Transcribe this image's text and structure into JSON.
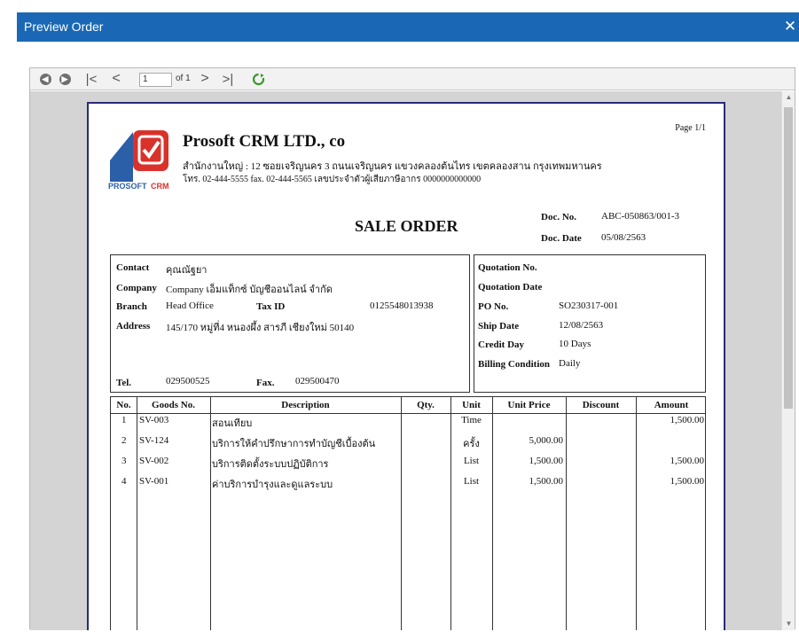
{
  "window": {
    "title": "Preview Order",
    "close_label": "✕"
  },
  "toolbar": {
    "page_value": "1",
    "page_of": "of 1"
  },
  "report": {
    "page_label": "Page 1/1",
    "company_name": "Prosoft CRM LTD., co",
    "address_line": "สำนักงานใหญ่ : 12 ซอยเจริญนคร 3 ถนนเจริญนคร แขวงคลองต้นไทร เขตคลองสาน กรุงเทพมหานคร",
    "phone_line": "โทร. 02-444-5555 fax. 02-444-5565 เลขประจำตัวผู้เสียภาษีอากร 0000000000000",
    "logo_text_a": "PROSOFT",
    "logo_text_b": "CRM",
    "doc_title": "SALE ORDER",
    "doc_no_label": "Doc. No.",
    "doc_no": "ABC-050863/001-3",
    "doc_date_label": "Doc. Date",
    "doc_date": "05/08/2563",
    "customer": {
      "contact_label": "Contact",
      "contact": "คุณณัฐยา",
      "company_label": "Company",
      "company": "Company เอ็มแท็กซ์ บัญชีออนไลน์ จำกัด",
      "branch_label": "Branch",
      "branch": "Head Office",
      "taxid_label": "Tax ID",
      "taxid": "0125548013938",
      "address_label": "Address",
      "address": "145/170 หมู่ที่4 หนองผึ้ง สารภี เชียงใหม่ 50140",
      "tel_label": "Tel.",
      "tel": "029500525",
      "fax_label": "Fax.",
      "fax": "029500470"
    },
    "order": {
      "quotation_no_label": "Quotation No.",
      "quotation_date_label": "Quotation Date",
      "po_no_label": "PO No.",
      "po_no": "SO230317-001",
      "ship_date_label": "Ship Date",
      "ship_date": "12/08/2563",
      "credit_day_label": "Credit Day",
      "credit_day": "10 Days",
      "billing_label": "Billing Condition",
      "billing": "Daily"
    },
    "columns": [
      "No.",
      "Goods No.",
      "Description",
      "Qty.",
      "Unit",
      "Unit Price",
      "Discount",
      "Amount"
    ],
    "rows": [
      {
        "no": "1",
        "goods": "SV-003",
        "desc": "สอนเทียบ",
        "qty": "",
        "unit": "Time",
        "price": "",
        "discount": "",
        "amount": "1,500.00"
      },
      {
        "no": "2",
        "goods": "SV-124",
        "desc": "บริการให้คำปรึกษาการทำบัญชีเบื้องต้น",
        "qty": "",
        "unit": "ครั้ง",
        "price": "5,000.00",
        "discount": "",
        "amount": ""
      },
      {
        "no": "3",
        "goods": "SV-002",
        "desc": "บริการติดตั้งระบบปฏิบัติการ",
        "qty": "",
        "unit": "List",
        "price": "1,500.00",
        "discount": "",
        "amount": "1,500.00"
      },
      {
        "no": "4",
        "goods": "SV-001",
        "desc": "ค่าบริการบำรุงและดูแลระบบ",
        "qty": "",
        "unit": "List",
        "price": "1,500.00",
        "discount": "",
        "amount": "1,500.00"
      }
    ]
  },
  "colors": {
    "title_bar": "#1a68b5",
    "logo_red": "#d9322b",
    "logo_blue": "#2b5fa8"
  }
}
